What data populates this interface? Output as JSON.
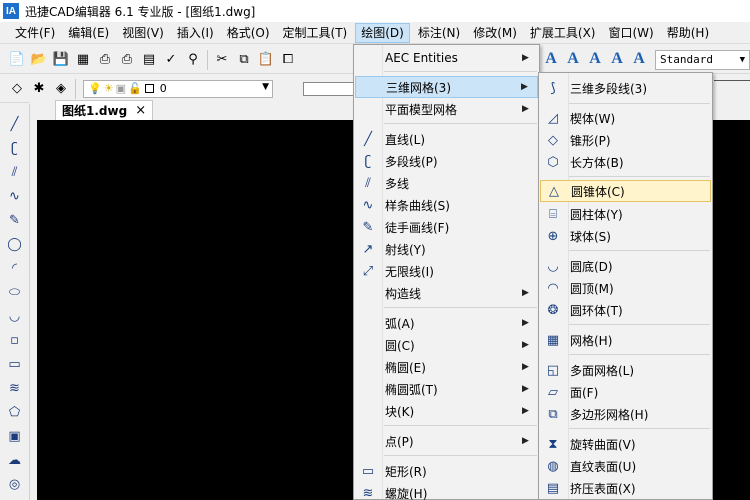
{
  "window": {
    "title": "迅捷CAD编辑器 6.1 专业版  - [图纸1.dwg]",
    "logo": "IA"
  },
  "menubar": [
    "文件(F)",
    "编辑(E)",
    "视图(V)",
    "插入(I)",
    "格式(O)",
    "定制工具(T)",
    "绘图(D)",
    "标注(N)",
    "修改(M)",
    "扩展工具(X)",
    "窗口(W)",
    "帮助(H)"
  ],
  "toolbar": {
    "layer_value": "0",
    "text_style": "Standard"
  },
  "document_tab": {
    "name": "图纸1.dwg",
    "close": "×"
  },
  "draw_menu": [
    {
      "label": "AEC Entities",
      "submenu": true
    },
    {
      "label": "三维网格(3)",
      "submenu": true,
      "highlighted": true
    },
    {
      "label": "平面模型网格",
      "submenu": true
    },
    {
      "label": "直线(L)",
      "icon": "line-icon"
    },
    {
      "label": "多段线(P)",
      "icon": "polyline-icon"
    },
    {
      "label": "多线",
      "icon": "multiline-icon"
    },
    {
      "label": "样条曲线(S)",
      "icon": "spline-icon"
    },
    {
      "label": "徒手画线(F)",
      "icon": "freehand-icon"
    },
    {
      "label": "射线(Y)",
      "icon": "ray-icon"
    },
    {
      "label": "无限线(I)",
      "icon": "xline-icon"
    },
    {
      "label": "构造线",
      "submenu": true
    },
    {
      "label": "弧(A)",
      "submenu": true
    },
    {
      "label": "圆(C)",
      "submenu": true
    },
    {
      "label": "椭圆(E)",
      "submenu": true
    },
    {
      "label": "椭圆弧(T)",
      "submenu": true
    },
    {
      "label": "块(K)",
      "submenu": true
    },
    {
      "label": "点(P)",
      "submenu": true
    },
    {
      "label": "矩形(R)",
      "icon": "rectangle-icon"
    },
    {
      "label": "螺旋(H)",
      "icon": "helix-icon"
    }
  ],
  "mesh_menu": [
    {
      "label": "三维多段线(3)",
      "icon": "3d-polyline-icon"
    },
    {
      "label": "楔体(W)",
      "icon": "wedge-icon"
    },
    {
      "label": "锥形(P)",
      "icon": "pyramid-icon"
    },
    {
      "label": "长方体(B)",
      "icon": "box-icon"
    },
    {
      "label": "圆锥体(C)",
      "icon": "cone-icon",
      "highlighted": true
    },
    {
      "label": "圆柱体(Y)",
      "icon": "cylinder-icon"
    },
    {
      "label": "球体(S)",
      "icon": "sphere-icon"
    },
    {
      "label": "圆底(D)",
      "icon": "dish-icon"
    },
    {
      "label": "圆顶(M)",
      "icon": "dome-icon"
    },
    {
      "label": "圆环体(T)",
      "icon": "torus-icon"
    },
    {
      "label": "网格(H)",
      "icon": "mesh-icon"
    },
    {
      "label": "多面网格(L)",
      "icon": "polyface-icon"
    },
    {
      "label": "面(F)",
      "icon": "face-icon"
    },
    {
      "label": "多边形网格(H)",
      "icon": "polygon-mesh-icon"
    },
    {
      "label": "旋转曲面(V)",
      "icon": "revolved-surface-icon"
    },
    {
      "label": "直纹表面(U)",
      "icon": "ruled-surface-icon"
    },
    {
      "label": "挤压表面(X)",
      "icon": "extruded-surface-icon"
    }
  ]
}
